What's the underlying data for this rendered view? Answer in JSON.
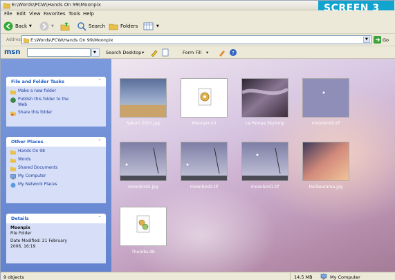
{
  "titlebar": {
    "title": "E:\\Words\\PCW\\Hands On 99\\Moonpix"
  },
  "badge": "SCREEN 3",
  "menu": [
    "File",
    "Edit",
    "View",
    "Favorites",
    "Tools",
    "Help"
  ],
  "toolbar": {
    "back": "Back",
    "search": "Search",
    "folders": "Folders"
  },
  "address": {
    "label": "Address",
    "value": "E:\\Words\\PCW\\Hands On 99\\Moonpix",
    "go": "Go"
  },
  "msn": {
    "logo": "msn",
    "search_desktop": "Search Desktop",
    "form_fill": "Form Fill"
  },
  "tasks": {
    "title": "File and Folder Tasks",
    "items": [
      "Make a new folder",
      "Publish this folder to the",
      "Web",
      "Share this folder"
    ]
  },
  "other_places": {
    "title": "Other Places",
    "items": [
      "Hands On 98",
      "Words",
      "Shared Documents",
      "My Computer",
      "My Network Places"
    ]
  },
  "details": {
    "title": "Details",
    "name": "Moonpix",
    "type": "File Folder",
    "modified": "Date Modified: 21 February",
    "modified2": "2006, 16:19"
  },
  "files": [
    {
      "name": "Saturn 2001.jpg"
    },
    {
      "name": "Moonpix.ini"
    },
    {
      "name": "La Pampa Sky.bmp"
    },
    {
      "name": "moonbird2.tif"
    },
    {
      "name": "moonbird3.jpg"
    },
    {
      "name": "moonbird2.tif"
    },
    {
      "name": "moonbird1.tif"
    },
    {
      "name": "Harbourarea.jpg"
    },
    {
      "name": "Thumbs.db"
    }
  ],
  "status": {
    "objects": "9 objects",
    "size": "14.5 MB",
    "location": "My Computer"
  }
}
